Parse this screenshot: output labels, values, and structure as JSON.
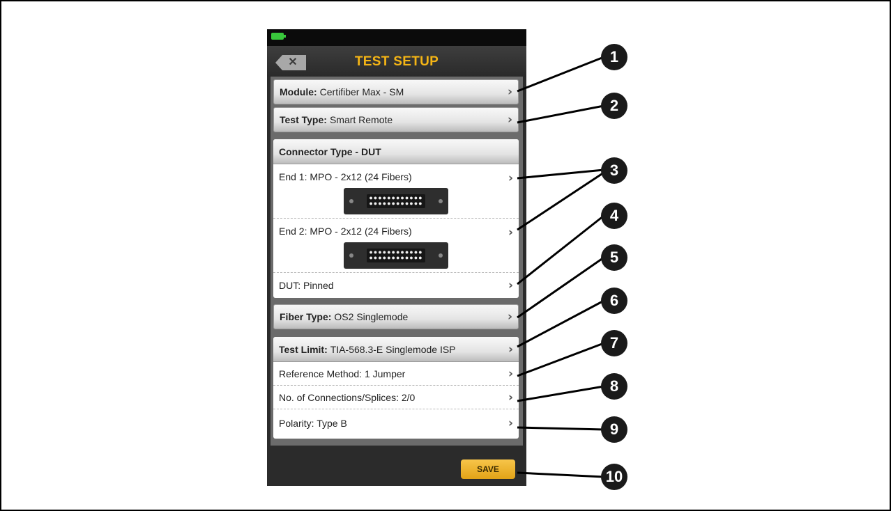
{
  "screen": {
    "title": "TEST SETUP",
    "back_icon": "close-icon",
    "battery_color": "#39c83c",
    "accent_color": "#f5b515"
  },
  "module": {
    "label": "Module:",
    "value": "Certifiber Max - SM"
  },
  "test_type": {
    "label": "Test Type:",
    "value": "Smart Remote"
  },
  "connector": {
    "header": "Connector Type - DUT",
    "end1": "End 1: MPO - 2x12 (24 Fibers)",
    "end2": "End 2: MPO - 2x12 (24 Fibers)",
    "dut": "DUT: Pinned"
  },
  "fiber_type": {
    "label": "Fiber Type:",
    "value": "OS2 Singlemode"
  },
  "test_limit": {
    "label": "Test Limit:",
    "value": "TIA-568.3-E Singlemode ISP"
  },
  "settings": {
    "reference_method": "Reference Method: 1 Jumper",
    "connections": "No. of Connections/Splices: 2/0",
    "polarity": "Polarity: Type B"
  },
  "save_label": "SAVE",
  "callouts": [
    "1",
    "2",
    "3",
    "4",
    "5",
    "6",
    "7",
    "8",
    "9",
    "10"
  ]
}
